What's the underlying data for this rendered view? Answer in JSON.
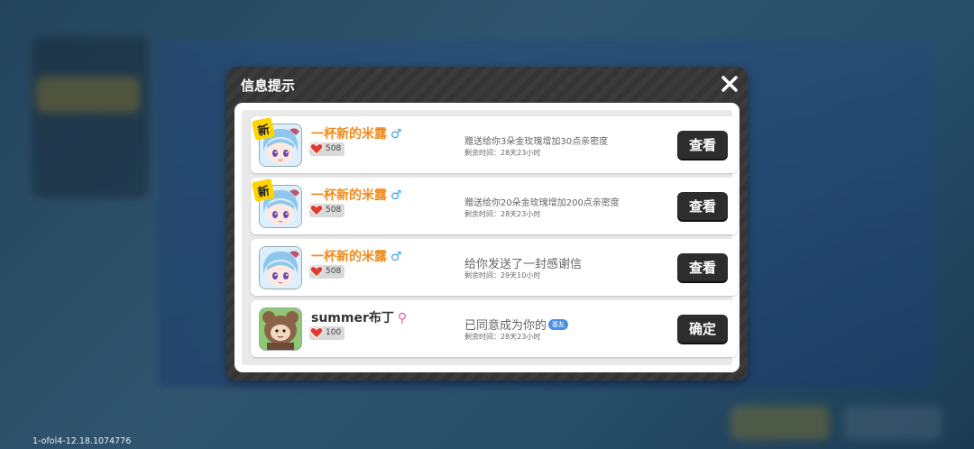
{
  "dialog": {
    "title": "信息提示"
  },
  "messages": [
    {
      "new": true,
      "new_label": "新",
      "name": "一杯新的米露",
      "gender_symbol": "♂",
      "intimacy": "508",
      "text": "赠送给你3朵金玫瑰增加30点亲密度",
      "time_label": "剩余时间：28天23小时",
      "action": "查看",
      "avatar": "anime-girl-avatar"
    },
    {
      "new": true,
      "new_label": "新",
      "name": "一杯新的米露",
      "gender_symbol": "♂",
      "intimacy": "508",
      "text": "赠送给你20朵金玫瑰增加200点亲密度",
      "time_label": "剩余时间：28天23小时",
      "action": "查看",
      "avatar": "anime-girl-avatar"
    },
    {
      "new": false,
      "name": "一杯新的米露",
      "gender_symbol": "♂",
      "intimacy": "508",
      "text": "给你发送了一封感谢信",
      "time_label": "剩余时间：29天10小时",
      "action": "查看",
      "avatar": "anime-girl-avatar"
    },
    {
      "new": false,
      "name": "summer布丁",
      "gender_symbol": "⚲",
      "intimacy": "100",
      "text": "已同意成为你的",
      "tag": "基友",
      "time_label": "剩余时间：28天23小时",
      "action": "确定",
      "avatar": "bear-costume-avatar"
    }
  ],
  "footer": {
    "version": "1-ofol4-12.18.1074776"
  },
  "colors": {
    "name_orange": "#f08a1c",
    "male_blue": "#37a6e8",
    "female_pink": "#e65aa8",
    "button_dark": "#2d2d2d",
    "tag_blue": "#4b8fe0"
  }
}
